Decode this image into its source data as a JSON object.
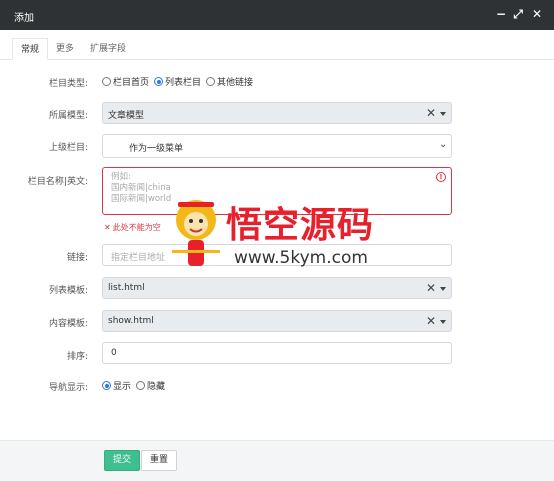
{
  "window": {
    "title": "添加"
  },
  "tabs": [
    {
      "label": "常规"
    },
    {
      "label": "更多"
    },
    {
      "label": "扩展字段"
    }
  ],
  "form": {
    "column_type": {
      "label": "栏目类型:",
      "options": [
        "栏目首页",
        "列表栏目",
        "其他链接"
      ],
      "selected": "列表栏目"
    },
    "model": {
      "label": "所属模型:",
      "value": "文章模型"
    },
    "parent": {
      "label": "上级栏目:",
      "value": "作为一级菜单"
    },
    "name": {
      "label": "栏目名称|英文:",
      "placeholder_lines": [
        "例如:",
        "国内新闻|china",
        "国际新闻|world"
      ],
      "error": "此处不能为空"
    },
    "link": {
      "label": "链接:",
      "placeholder": "指定栏目地址"
    },
    "list_template": {
      "label": "列表模板:",
      "value": "list.html"
    },
    "content_template": {
      "label": "内容模板:",
      "value": "show.html"
    },
    "order": {
      "label": "排序:",
      "value": "0"
    },
    "nav_display": {
      "label": "导航显示:",
      "options": [
        "显示",
        "隐藏"
      ],
      "selected": "显示"
    }
  },
  "footer": {
    "submit_label": "提交",
    "reset_label": "重置"
  },
  "watermark": {
    "title": "悟空源码",
    "url": "www.5kym.com"
  },
  "colors": {
    "titlebar": "#2f3234",
    "accent": "#2f77e0",
    "error": "#dc3545",
    "submit": "#3fbf8f",
    "watermark_red": "#e8202b"
  },
  "icons": {
    "minimize": "minus-icon",
    "maximize": "expand-icon",
    "close": "close-icon",
    "select_clear": "clear-icon",
    "select_caret": "caret-down-icon",
    "error": "error-circle-icon"
  }
}
